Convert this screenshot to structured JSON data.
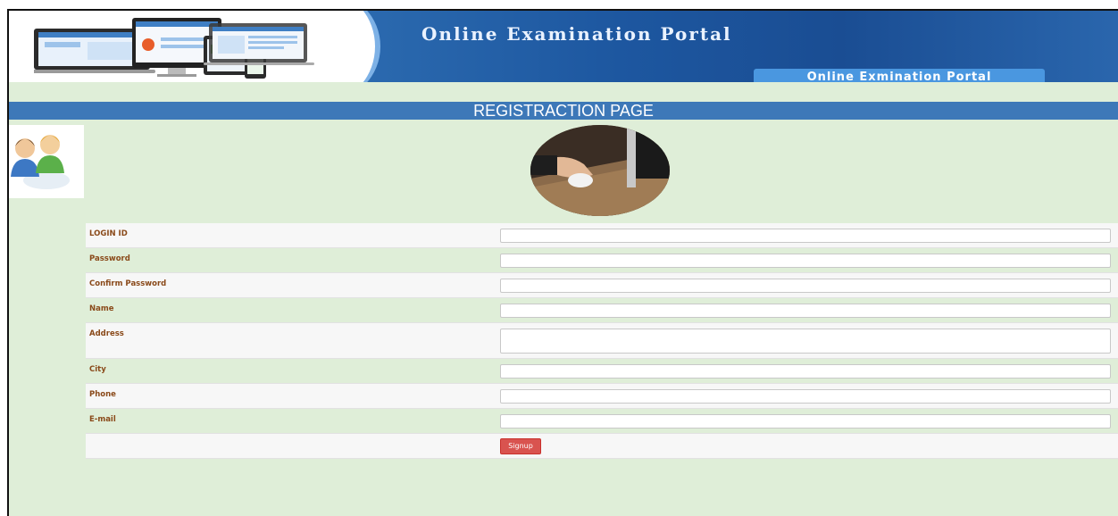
{
  "header": {
    "title": "Online Examination Portal",
    "badge": "Online Exmination Portal"
  },
  "band_title": "REGISTRACTION PAGE",
  "form": {
    "fields": [
      {
        "label": "LOGIN ID",
        "value": ""
      },
      {
        "label": "Password",
        "value": ""
      },
      {
        "label": "Confirm Password",
        "value": ""
      },
      {
        "label": "Name",
        "value": ""
      },
      {
        "label": "Address",
        "value": ""
      },
      {
        "label": "City",
        "value": ""
      },
      {
        "label": "Phone",
        "value": ""
      },
      {
        "label": "E-mail",
        "value": ""
      }
    ],
    "submit_label": "Signup"
  },
  "colors": {
    "page_bg": "#dfeed8",
    "band": "#3d78b8",
    "label": "#8a4a1a",
    "button": "#d9534f"
  },
  "icons": [
    "devices-banner-image",
    "users-icon",
    "mouse-desk-photo"
  ]
}
